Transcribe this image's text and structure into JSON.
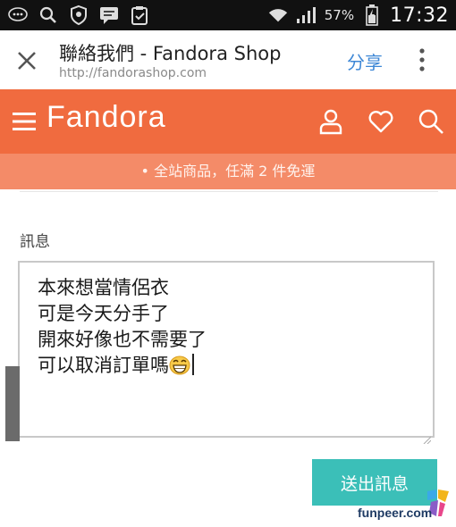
{
  "status_bar": {
    "battery": "57%",
    "time": "17:32"
  },
  "browser": {
    "title": "聯絡我們 - Fandora Shop",
    "url": "http://fandorashop.com",
    "share_label": "分享"
  },
  "site": {
    "logo": "Fandora",
    "promo": "• 全站商品，任滿 2 件免運",
    "accent": "#f06b3f",
    "promo_bg": "#f48b68"
  },
  "form": {
    "message_label": "訊息",
    "message_lines": [
      "本來想當情侶衣",
      "可是今天分手了",
      "開來好像也不需要了",
      "可以取消訂單嗎"
    ],
    "submit_label": "送出訊息",
    "submit_color": "#3bbfb8"
  },
  "watermark": {
    "text": "funpeer.com"
  }
}
